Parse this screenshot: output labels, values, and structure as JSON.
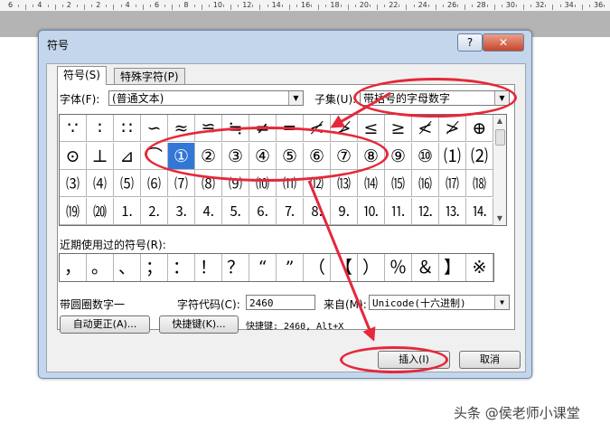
{
  "ruler": {
    "numbers": [
      "6",
      "4",
      "2",
      "2",
      "4",
      "6",
      "8",
      "10",
      "12",
      "14",
      "16",
      "18",
      "20",
      "22",
      "24",
      "26",
      "28",
      "30",
      "32",
      "34",
      "36"
    ]
  },
  "dialog": {
    "title": "符号",
    "help_label": "?",
    "close_label": "✕",
    "tabs": [
      {
        "label": "符号(S)"
      },
      {
        "label": "特殊字符(P)"
      }
    ],
    "font_label": "字体(F):",
    "font_value": "(普通文本)",
    "subset_label": "子集(U):",
    "subset_value": "带括号的字母数字",
    "symbol_rows": [
      [
        "∵",
        "∶",
        "∷",
        "∽",
        "≈",
        "≌",
        "≒",
        "≠",
        "═",
        "≮",
        "≯",
        "≤",
        "≥",
        "≮",
        "≯",
        "⊕"
      ],
      [
        "⊙",
        "⊥",
        "⊿",
        "⌒",
        "①",
        "②",
        "③",
        "④",
        "⑤",
        "⑥",
        "⑦",
        "⑧",
        "⑨",
        "⑩",
        "⑴",
        "⑵"
      ],
      [
        "⑶",
        "⑷",
        "⑸",
        "⑹",
        "⑺",
        "⑻",
        "⑼",
        "⑽",
        "⑾",
        "⑿",
        "⒀",
        "⒁",
        "⒂",
        "⒃",
        "⒄",
        "⒅"
      ],
      [
        "⒆",
        "⒇",
        "⒈",
        "⒉",
        "⒊",
        "⒋",
        "⒌",
        "⒍",
        "⒎",
        "⒏",
        "⒐",
        "⒑",
        "⒒",
        "⒓",
        "⒔",
        "⒕"
      ]
    ],
    "recent_label": "近期使用过的符号(R):",
    "recent_symbols": [
      "，",
      "。",
      "、",
      "；",
      "：",
      "！",
      "？",
      "“",
      "”",
      "（",
      "【",
      "）",
      "％",
      "＆",
      "】",
      "※"
    ],
    "char_name": "带圆圈数字一",
    "charcode_label": "字符代码(C):",
    "charcode_value": "2460",
    "from_label": "来自(M):",
    "from_value": "Unicode(十六进制)",
    "autocorrect_label": "自动更正(A)...",
    "shortcut_key_label": "快捷键(K)...",
    "shortcut_text": "快捷键: 2460, Alt+X",
    "insert_label": "插入(I)",
    "cancel_label": "取消"
  },
  "watermark": "头条 @侯老师小课堂",
  "colors": {
    "annotation": "#e5283a",
    "selection": "#3277d6",
    "dialog_frame": "#c3d6ec"
  }
}
